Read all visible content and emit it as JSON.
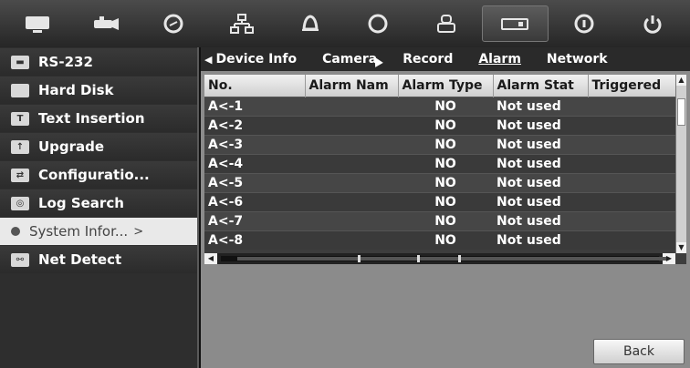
{
  "toolbar": {
    "icons": [
      "monitor-icon",
      "camera-icon",
      "playback-icon",
      "network-icon",
      "alarm-bell-icon",
      "record-icon",
      "user-icon",
      "system-info-icon",
      "info-icon",
      "power-icon"
    ]
  },
  "sidebar": {
    "items": [
      {
        "label": "RS-232",
        "icon": "serial-port-icon"
      },
      {
        "label": "Hard Disk",
        "icon": "hdd-icon"
      },
      {
        "label": "Text Insertion",
        "icon": "text-insert-icon"
      },
      {
        "label": "Upgrade",
        "icon": "upgrade-icon"
      },
      {
        "label": "Configuratio...",
        "icon": "configuration-icon"
      },
      {
        "label": "Log Search",
        "icon": "log-search-icon"
      },
      {
        "label": "System Infor...",
        "icon": "system-info-icon",
        "arrow": ">"
      },
      {
        "label": "Net Detect",
        "icon": "net-detect-icon"
      }
    ]
  },
  "tabs": {
    "prev_arrow": "◀",
    "items": [
      "Device Info",
      "Camera",
      "Record",
      "Alarm",
      "Network"
    ],
    "current": "Alarm"
  },
  "table": {
    "columns": [
      "No.",
      "Alarm Nam",
      "Alarm Type",
      "Alarm Stat",
      "Triggered"
    ],
    "rows": [
      [
        "A<-1",
        "",
        "NO",
        "Not used",
        ""
      ],
      [
        "A<-2",
        "",
        "NO",
        "Not used",
        ""
      ],
      [
        "A<-3",
        "",
        "NO",
        "Not used",
        ""
      ],
      [
        "A<-4",
        "",
        "NO",
        "Not used",
        ""
      ],
      [
        "A<-5",
        "",
        "NO",
        "Not used",
        ""
      ],
      [
        "A<-6",
        "",
        "NO",
        "Not used",
        ""
      ],
      [
        "A<-7",
        "",
        "NO",
        "Not used",
        ""
      ],
      [
        "A<-8",
        "",
        "NO",
        "Not used",
        ""
      ]
    ]
  },
  "back_label": "Back"
}
